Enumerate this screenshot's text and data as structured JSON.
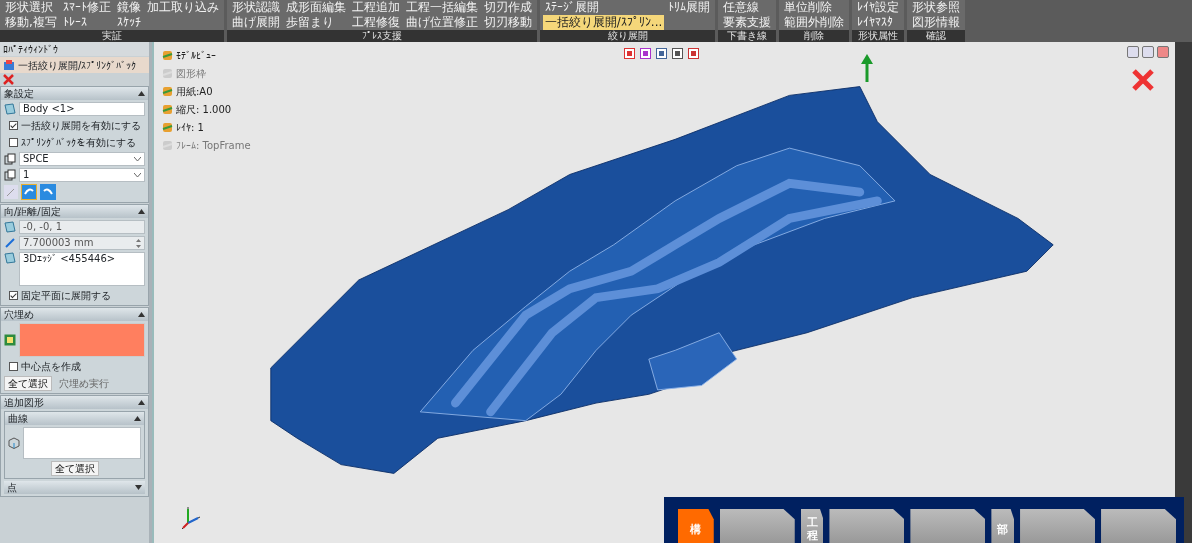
{
  "ribbon": {
    "groups": [
      {
        "label": "実証",
        "buttons": [
          {
            "label": "形状選択",
            "selected": false
          },
          {
            "label": "移動,複写",
            "selected": false
          },
          {
            "label": "ｽﾏｰﾄ修正",
            "selected": false
          },
          {
            "label": "ﾄﾚｰｽ",
            "selected": false
          },
          {
            "label": "鏡像",
            "selected": false
          },
          {
            "label": "ｽｹｯﾁ",
            "selected": false
          },
          {
            "label": "加工取り込み",
            "selected": false
          }
        ]
      },
      {
        "label": "ﾌﾟﾚｽ支援",
        "buttons": [
          {
            "label": "形状認識",
            "selected": false
          },
          {
            "label": "曲げ展開",
            "selected": false
          },
          {
            "label": "成形面編集",
            "selected": false
          },
          {
            "label": "歩留まり",
            "selected": false
          },
          {
            "label": "工程追加",
            "selected": false
          },
          {
            "label": "工程修復",
            "selected": false
          },
          {
            "label": "工程一括編集",
            "selected": false
          },
          {
            "label": "曲げ位置修正",
            "selected": false
          },
          {
            "label": "切刃作成",
            "selected": false
          },
          {
            "label": "切刃移動",
            "selected": false
          }
        ]
      },
      {
        "label": "絞り展開",
        "buttons": [
          {
            "label": "ｽﾃｰｼﾞ展開",
            "selected": false
          },
          {
            "label": "一括絞り展開/ｽﾌﾟﾘﾝ...",
            "selected": true
          },
          {
            "label": "ﾄﾘﾑ展開",
            "selected": false
          }
        ]
      },
      {
        "label": "下書き線",
        "buttons": [
          {
            "label": "任意線",
            "selected": false
          },
          {
            "label": "要素支援",
            "selected": false
          }
        ]
      },
      {
        "label": "削除",
        "buttons": [
          {
            "label": "単位削除",
            "selected": false
          },
          {
            "label": "範囲外削除",
            "selected": false
          }
        ]
      },
      {
        "label": "形状属性",
        "buttons": [
          {
            "label": "ﾚｲﾔ設定",
            "selected": false
          },
          {
            "label": "ﾚｲﾔﾏｽﾀ",
            "selected": false
          }
        ]
      },
      {
        "label": "確認",
        "buttons": [
          {
            "label": "形状参照",
            "selected": false
          },
          {
            "label": "図形情報",
            "selected": false
          }
        ]
      }
    ]
  },
  "property_panel": {
    "title": "ﾛﾊﾟﾃｨｳｨﾝﾄﾞｳ",
    "command": "一括絞り展開/ｽﾌﾟﾘﾝｸﾞﾊﾞｯｸ",
    "sections": [
      {
        "title": "象設定",
        "items": [
          {
            "kind": "field",
            "value": "Body <1>",
            "disabled": false
          },
          {
            "kind": "check",
            "label": "一括絞り展開を有効にする",
            "checked": true
          },
          {
            "kind": "check",
            "label": "ｽﾌﾟﾘﾝｸﾞﾊﾞｯｸを有効にする",
            "checked": false
          },
          {
            "kind": "select",
            "value": "SPCE"
          },
          {
            "kind": "select",
            "value": "1"
          },
          {
            "kind": "iconrow"
          }
        ]
      },
      {
        "title": "向/距離/固定",
        "items": [
          {
            "kind": "field",
            "value": "-0, -0, 1",
            "disabled": true
          },
          {
            "kind": "spin",
            "value": "7.700003 mm"
          },
          {
            "kind": "area",
            "value": "3Dｴｯｼﾞ  <455446>"
          },
          {
            "kind": "check",
            "label": "固定平面に展開する",
            "checked": true
          }
        ]
      },
      {
        "title": "穴埋め",
        "items": [
          {
            "kind": "swatch",
            "color": "#ff7f5f"
          },
          {
            "kind": "check",
            "label": "中心点を作成",
            "checked": false
          },
          {
            "kind": "buttons",
            "buttons": [
              {
                "label": "全て選択",
                "disabled": false
              },
              {
                "label": "穴埋め実行",
                "disabled": true
              }
            ]
          }
        ]
      },
      {
        "title": "追加図形",
        "items": [
          {
            "kind": "subsection",
            "title": "曲線",
            "button": "全て選択"
          },
          {
            "kind": "collapsed",
            "title": "点"
          }
        ]
      }
    ]
  },
  "viewport": {
    "info": [
      {
        "label": "ﾓﾃﾞﾙﾋﾞｭｰ",
        "disabled": false
      },
      {
        "label": "図形枠",
        "disabled": true
      },
      {
        "label": "用紙:A0",
        "disabled": false
      },
      {
        "label": "縮尺: 1.000",
        "disabled": false
      },
      {
        "label": "ﾚｲﾔ: 1",
        "disabled": false
      },
      {
        "label": "ﾌﾚｰﾑ: TopFrame",
        "disabled": true
      }
    ],
    "tabs": [
      {
        "label": "構",
        "selected": true
      },
      {
        "selected": false
      },
      {
        "label": "工程",
        "selected": false
      },
      {
        "selected": false
      },
      {
        "selected": false
      },
      {
        "label": "部",
        "selected": false
      },
      {
        "selected": false
      },
      {
        "selected": false
      }
    ]
  }
}
